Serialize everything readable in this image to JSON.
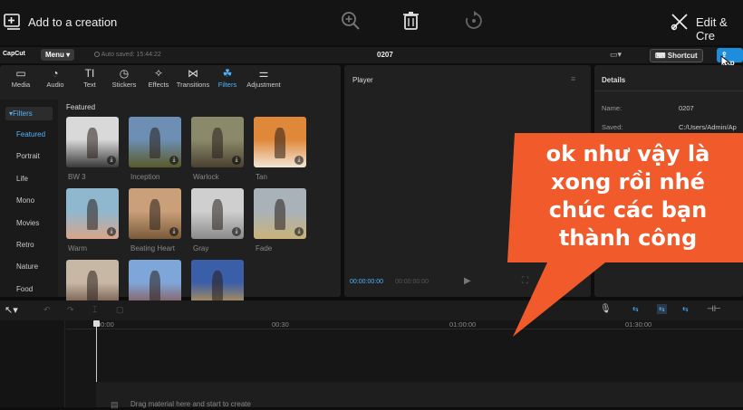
{
  "top_bar": {
    "add_label": "Add to a creation",
    "edit_label": "Edit & Cre"
  },
  "app_bar": {
    "logo": "CapCut",
    "menu_label": "Menu",
    "autosave": "Auto saved: 15:44:22",
    "project_title": "0207",
    "shortcut_label": "Shortcut",
    "export_label": "Exp"
  },
  "media_tabs": [
    {
      "label": "Media",
      "icon": "media-icon",
      "glyph": "▭"
    },
    {
      "label": "Audio",
      "icon": "audio-icon",
      "glyph": "◔"
    },
    {
      "label": "Text",
      "icon": "text-icon",
      "glyph": "TI"
    },
    {
      "label": "Stickers",
      "icon": "stickers-icon",
      "glyph": "◷"
    },
    {
      "label": "Effects",
      "icon": "effects-icon",
      "glyph": "✧"
    },
    {
      "label": "Transitions",
      "icon": "transitions-icon",
      "glyph": "⋈"
    },
    {
      "label": "Filters",
      "icon": "filters-icon",
      "glyph": "☘"
    },
    {
      "label": "Adjustment",
      "icon": "adjustment-icon",
      "glyph": "⚌"
    }
  ],
  "active_tab": "Filters",
  "filter_panel": {
    "header": "Filters",
    "categories": [
      "Featured",
      "Portrait",
      "Life",
      "Mono",
      "Movies",
      "Retro",
      "Nature",
      "Food"
    ],
    "section_title": "Featured",
    "items": [
      {
        "name": "BW 3",
        "colors": [
          "#d9d9d9",
          "#3a3a3a"
        ]
      },
      {
        "name": "Inception",
        "colors": [
          "#6d8fb3",
          "#5a5a2a"
        ]
      },
      {
        "name": "Warlock",
        "colors": [
          "#8a8a6a",
          "#4a4030"
        ]
      },
      {
        "name": "Tan",
        "colors": [
          "#e0883a",
          "#f2e6d6"
        ]
      },
      {
        "name": "Warm",
        "colors": [
          "#8fb8cf",
          "#d9a58a"
        ]
      },
      {
        "name": "Beating Heart",
        "colors": [
          "#c9a07a",
          "#7a5a3a"
        ]
      },
      {
        "name": "Gray",
        "colors": [
          "#cfcfcf",
          "#8a8a8a"
        ]
      },
      {
        "name": "Fade",
        "colors": [
          "#a8b2b8",
          "#c9b27a"
        ]
      },
      {
        "name": "",
        "colors": [
          "#c7b8a6",
          "#5a4030"
        ]
      },
      {
        "name": "",
        "colors": [
          "#7fa6d9",
          "#8a4a3a"
        ]
      },
      {
        "name": "",
        "colors": [
          "#3a5fa8",
          "#d9a03a"
        ]
      }
    ]
  },
  "player": {
    "title": "Player",
    "time_current": "00:00:00:00",
    "time_total": "00:00:00:00"
  },
  "details": {
    "title": "Details",
    "rows": [
      {
        "key": "Name:",
        "value": "0207"
      },
      {
        "key": "Saved:",
        "value": "C:/Users/Admin/Ap"
      }
    ]
  },
  "timeline": {
    "ticks": [
      "00:00",
      "00:30",
      "01:00:00",
      "01:30:00"
    ],
    "hint": "Drag material here and start to create"
  },
  "overlay_bubble": {
    "lines": [
      "ok như vậy là",
      "xong rồi nhé",
      "chúc các bạn",
      "thành công"
    ],
    "color": "#f15a2a"
  }
}
